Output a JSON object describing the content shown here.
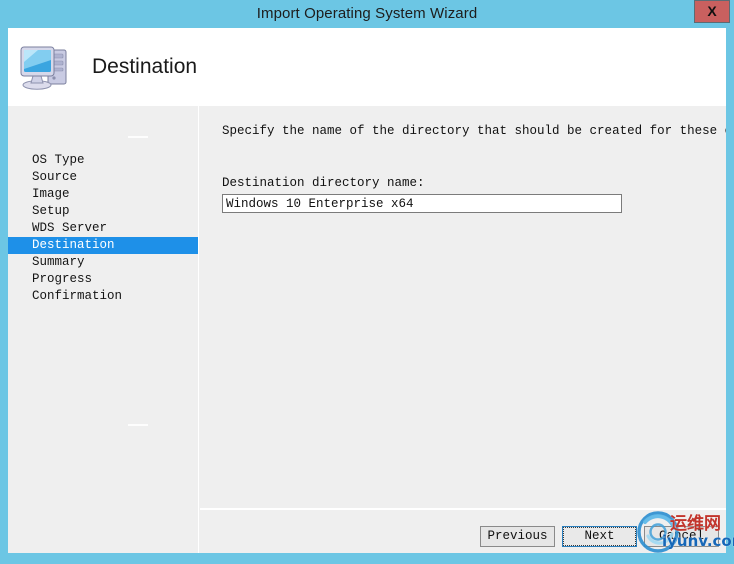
{
  "window": {
    "title": "Import Operating System Wizard",
    "close_label": "X",
    "border_color": "#6cc6e4",
    "titlebar_color": "#6cc6e4",
    "close_button_color": "#c9605f"
  },
  "header": {
    "heading": "Destination",
    "icon": "computer-icon"
  },
  "sidebar": {
    "items": [
      {
        "label": "OS Type",
        "selected": false
      },
      {
        "label": "Source",
        "selected": false
      },
      {
        "label": "Image",
        "selected": false
      },
      {
        "label": "Setup",
        "selected": false
      },
      {
        "label": "WDS Server",
        "selected": false
      },
      {
        "label": "Destination",
        "selected": true
      },
      {
        "label": "Summary",
        "selected": false
      },
      {
        "label": "Progress",
        "selected": false
      },
      {
        "label": "Confirmation",
        "selected": false
      }
    ],
    "selected_color": "#1e90e8"
  },
  "content": {
    "instruction": "Specify the name of the directory that should be created for these operating system fi",
    "field_label": "Destination directory name:",
    "directory_name": "Windows 10 Enterprise x64"
  },
  "footer": {
    "previous_label": "Previous",
    "next_label": "Next",
    "cancel_label": "Cancel",
    "focused_button": "Next"
  },
  "watermark": {
    "chinese_text": "运维网",
    "url_text": "iyunv.com",
    "logo": "swoosh-circle-logo",
    "chinese_color": "#c2352c",
    "url_color": "#1667b8"
  }
}
